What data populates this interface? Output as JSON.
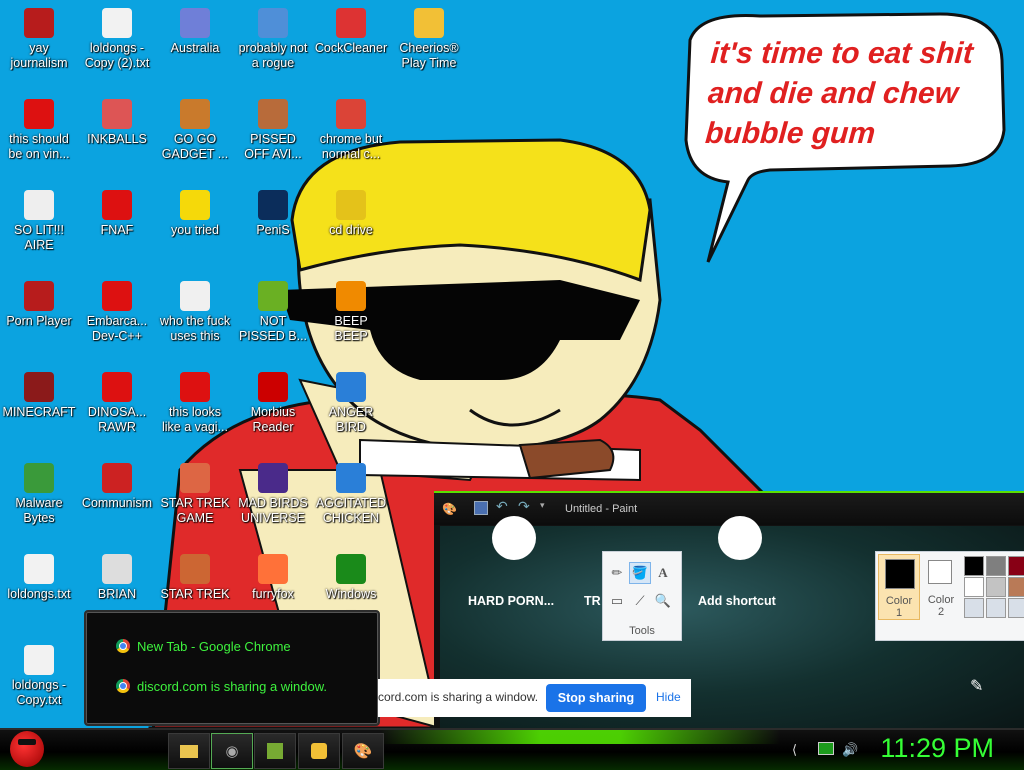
{
  "speech_bubble": {
    "lines": [
      "it's time to eat shit",
      "and die and chew",
      "bubble gum"
    ]
  },
  "desktop_icons": [
    {
      "name": "yay journalism",
      "icon": "flash-icon",
      "color": "#b71c1c"
    },
    {
      "name": "loldongs -\nCopy (2).txt",
      "icon": "text-file-icon",
      "color": "#f2f2f2"
    },
    {
      "name": "Australia",
      "icon": "globe-icon",
      "color": "#6f7fd8"
    },
    {
      "name": "probably not\na rogue",
      "icon": "gear-icon",
      "color": "#4f8fd8"
    },
    {
      "name": "CockCleaner",
      "icon": "ccleaner-icon",
      "color": "#d33"
    },
    {
      "name": "Cheerios®\nPlay Time",
      "icon": "cereal-icon",
      "color": "#f2c036"
    },
    {
      "name": "this should\nbe on vin...",
      "icon": "angry-bird-icon",
      "color": "#d11"
    },
    {
      "name": "INKBALLS",
      "icon": "inkball-icon",
      "color": "#d55"
    },
    {
      "name": "GO GO\nGADGET ...",
      "icon": "briefcase-icon",
      "color": "#c97a2c"
    },
    {
      "name": "PISSED\nOFF AVI...",
      "icon": "avatar-icon",
      "color": "#b86b3a"
    },
    {
      "name": "chrome but\nnormal c...",
      "icon": "chrome-icon",
      "color": "#db4437"
    },
    {
      "name": "SO LIT!!!\nAIRE",
      "icon": "cards-icon",
      "color": "#eee"
    },
    {
      "name": "FNAF",
      "icon": "angry-bird-icon",
      "color": "#d11"
    },
    {
      "name": "you tried",
      "icon": "star-icon",
      "color": "#f5d90a"
    },
    {
      "name": "PeniS",
      "icon": "photoshop-icon",
      "color": "#0b2d5b"
    },
    {
      "name": "cd drive",
      "icon": "cd-icon",
      "color": "#e4c21a"
    },
    {
      "name": "Porn Player",
      "icon": "flash-icon",
      "color": "#b71c1c"
    },
    {
      "name": "Embarca...\nDev-C++",
      "icon": "devcpp-icon",
      "color": "#d11"
    },
    {
      "name": "who the fuck\nuses this",
      "icon": "lightning-icon",
      "color": "#f0f0f0"
    },
    {
      "name": "NOT\nPISSED B...",
      "icon": "pig-icon",
      "color": "#6ab023"
    },
    {
      "name": "BEEP\nBEEP",
      "icon": "vlc-icon",
      "color": "#f08a00"
    },
    {
      "name": "MINECRAFT",
      "icon": "minecraft-icon",
      "color": "#8b1a1a"
    },
    {
      "name": "DINOSA...\nRAWR",
      "icon": "angry-bird-icon",
      "color": "#d11"
    },
    {
      "name": "this looks\nlike a vagi...",
      "icon": "opera-icon",
      "color": "#d11"
    },
    {
      "name": "Morbius\nReader",
      "icon": "acrobat-icon",
      "color": "#c00"
    },
    {
      "name": "ANGER\nBIRD",
      "icon": "angry-bird-icon",
      "color": "#2a7fd8"
    },
    {
      "name": "Malware\nBytes",
      "icon": "shield-icon",
      "color": "#3a9a3a"
    },
    {
      "name": "Communism",
      "icon": "communism-icon",
      "color": "#c22"
    },
    {
      "name": "STAR TREK\nGAME",
      "icon": "game-icon",
      "color": "#d64"
    },
    {
      "name": "MAD BIRDS\nUNIVERSE",
      "icon": "angry-bird-icon",
      "color": "#4a2a8a"
    },
    {
      "name": "AGGITATED\nCHICKEN",
      "icon": "angry-bird-icon",
      "color": "#2a7fd8"
    },
    {
      "name": "loldongs.txt",
      "icon": "text-file-icon",
      "color": "#f2f2f2"
    },
    {
      "name": "BRIAN",
      "icon": "brian-icon",
      "color": "#ddd"
    },
    {
      "name": "STAR TREK",
      "icon": "game-icon",
      "color": "#c63"
    },
    {
      "name": "furryfox",
      "icon": "firefox-icon",
      "color": "#ff7139"
    },
    {
      "name": "Windows\n...",
      "icon": "media-center-icon",
      "color": "#1a8a1a"
    },
    {
      "name": "loldongs -\nCopy.txt",
      "icon": "text-file-icon",
      "color": "#f2f2f2"
    }
  ],
  "notifications": [
    "New Tab - Google Chrome",
    "discord.com is sharing a window."
  ],
  "paint": {
    "title": "Untitled - Paint",
    "shortcuts": [
      "HARD PORN...",
      "TR",
      "Add shortcut"
    ],
    "tools_label": "Tools",
    "color1_label": "Color\n1",
    "color2_label": "Color\n2",
    "palette": [
      "#000000",
      "#7f7f7f",
      "#880015",
      "#ffffff",
      "#c3c3c3",
      "#b97a57",
      "#d8dfe8",
      "#d8dfe8",
      "#d8dfe8"
    ]
  },
  "share_bar": {
    "text": "cord.com is sharing a window.",
    "stop_label": "Stop sharing",
    "hide_label": "Hide"
  },
  "taskbar": {
    "clock": "11:29 PM"
  }
}
